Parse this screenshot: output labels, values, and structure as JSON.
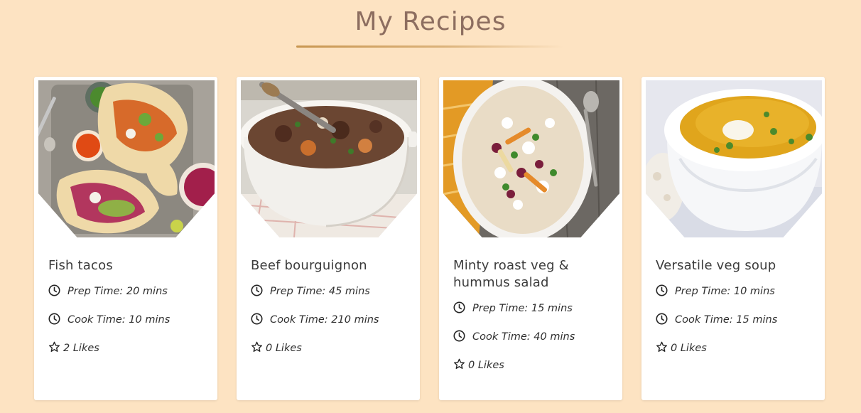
{
  "page": {
    "title": "My Recipes",
    "colors": {
      "background": "#fde3c2",
      "title": "#8d6e60",
      "accent": "#c89650"
    }
  },
  "recipes": [
    {
      "name": "Fish tacos",
      "prep": "Prep Time: 20 mins",
      "cook": "Cook Time: 10 mins",
      "likes": "2 Likes",
      "image": "fish-tacos-photo"
    },
    {
      "name": "Beef bourguignon",
      "prep": "Prep Time: 45 mins",
      "cook": "Cook Time: 210 mins",
      "likes": "0 Likes",
      "image": "beef-bourguignon-photo"
    },
    {
      "name": "Minty roast veg & hummus salad",
      "prep": "Prep Time: 15 mins",
      "cook": "Cook Time: 40 mins",
      "likes": "0 Likes",
      "image": "roast-veg-salad-photo"
    },
    {
      "name": "Versatile veg soup",
      "prep": "Prep Time: 10 mins",
      "cook": "Cook Time: 15 mins",
      "likes": "0 Likes",
      "image": "veg-soup-photo"
    }
  ],
  "icons": {
    "time": "clock-icon",
    "likes": "star-icon"
  }
}
